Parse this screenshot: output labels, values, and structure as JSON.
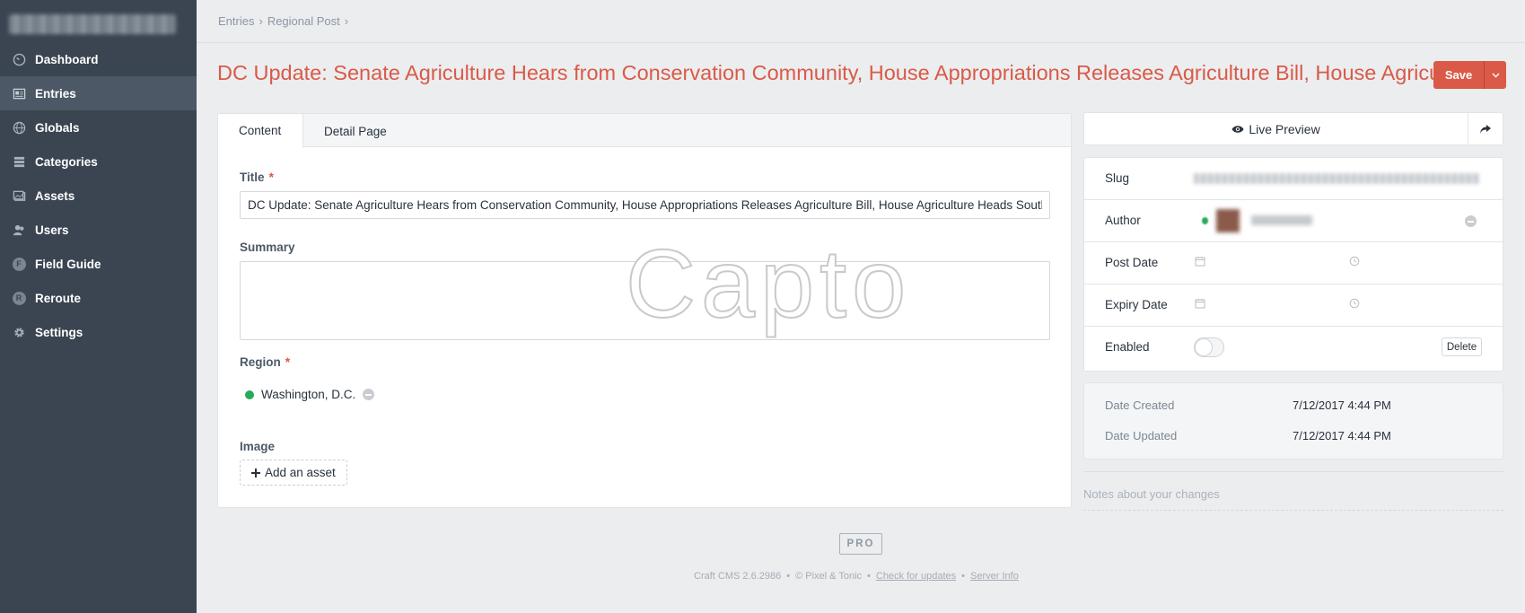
{
  "sidebar": {
    "items": [
      {
        "label": "Dashboard",
        "icon": "gauge-icon"
      },
      {
        "label": "Entries",
        "icon": "entries-icon",
        "active": true
      },
      {
        "label": "Globals",
        "icon": "globe-icon"
      },
      {
        "label": "Categories",
        "icon": "categories-icon"
      },
      {
        "label": "Assets",
        "icon": "assets-icon"
      },
      {
        "label": "Users",
        "icon": "users-icon"
      },
      {
        "label": "Field Guide",
        "icon": "letter-f-icon",
        "letter": "F"
      },
      {
        "label": "Reroute",
        "icon": "letter-r-icon",
        "letter": "R"
      },
      {
        "label": "Settings",
        "icon": "gear-icon"
      }
    ]
  },
  "breadcrumb": {
    "items": [
      "Entries",
      "Regional Post"
    ],
    "separator": "›"
  },
  "page": {
    "title": "DC Update: Senate Agriculture Hears from Conservation Community, House Appropriations Releases Agriculture Bill, House Agriculture Heads South",
    "save_label": "Save"
  },
  "tabs": [
    {
      "label": "Content",
      "selected": true
    },
    {
      "label": "Detail Page",
      "selected": false
    }
  ],
  "fields": {
    "title": {
      "label": "Title",
      "required_mark": "*",
      "value": "DC Update: Senate Agriculture Hears from Conservation Community, House Appropriations Releases Agriculture Bill, House Agriculture Heads South"
    },
    "summary": {
      "label": "Summary",
      "value": ""
    },
    "region": {
      "label": "Region",
      "required_mark": "*",
      "value": "Washington, D.C.",
      "status_color": "#27ab5a"
    },
    "image": {
      "label": "Image",
      "add_label": "Add an asset"
    }
  },
  "watermark": "Capto",
  "side": {
    "live_preview_label": "Live Preview",
    "meta": {
      "slug_label": "Slug",
      "author_label": "Author",
      "post_date_label": "Post Date",
      "expiry_date_label": "Expiry Date",
      "enabled_label": "Enabled",
      "enabled": false,
      "delete_label": "Delete"
    },
    "dates": {
      "created_label": "Date Created",
      "created_value": "7/12/2017 4:44 PM",
      "updated_label": "Date Updated",
      "updated_value": "7/12/2017 4:44 PM"
    },
    "notes_placeholder": "Notes about your changes"
  },
  "footer": {
    "badge": "PRO",
    "version": "Craft CMS 2.6.2986",
    "copyright": "© Pixel & Tonic",
    "links": [
      "Check for updates",
      "Server Info"
    ],
    "separator": "•"
  },
  "colors": {
    "accent": "#da5a47",
    "sidebar": "#3a4551",
    "active": "#4c5866"
  }
}
